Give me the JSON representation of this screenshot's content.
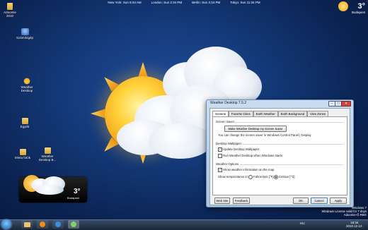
{
  "clocks": [
    "New York: Sun 8:34 AM",
    "London: Sun 2:34 PM",
    "Berlin: Sun 3:34 PM",
    "Tokyo: Sun 11:34 PM"
  ],
  "top_right_weather": {
    "temp": "3°",
    "city": "Budapest"
  },
  "desktop_icons": [
    {
      "label": "Adoomie\n2010",
      "icon": "folder-icon"
    },
    {
      "label": "Számítógép",
      "icon": "computer-icon"
    },
    {
      "label": "Weather\nDesktop",
      "icon": "weather-icon"
    },
    {
      "label": "Egyéb",
      "icon": "folder-icon"
    },
    {
      "label": "Minta fotók",
      "icon": "folder-icon"
    },
    {
      "label": "Weather\nDesktop B...",
      "icon": "folder-icon"
    }
  ],
  "gadget": {
    "temp": "3°",
    "city": "Budapest"
  },
  "dialog": {
    "title": "Weather Desktop 7.5.2",
    "tabs": [
      "General",
      "Favorite Cities",
      "Earth Weather",
      "Earth Background",
      "View Zones"
    ],
    "screen_saver_header": "Screen Saver",
    "screen_saver_button": "Make Weather Desktop my Screen Saver",
    "screen_saver_note": "You can change the screen saver in Windows Control Panel | Display",
    "wallpaper_header": "Desktop Wallpaper",
    "update_wallpaper": "Update Desktop Wallpaper",
    "run_on_start": "Run Weather Desktop when Windows starts",
    "weather_options_header": "Weather Options",
    "show_on_map": "Show weather information on the map",
    "temp_label": "Show temperatures in:",
    "fahrenheit": "Fahrenheit [°F]",
    "celsius": "Celsius [°C]",
    "buttons": {
      "website": "Web Site",
      "feedback": "Feedback",
      "ok": "OK",
      "cancel": "Cancel",
      "apply": "Apply"
    }
  },
  "watermark": {
    "line1": "Windows 7",
    "line2": "Windows License valid for 7 days",
    "line3": "Adoomie-Ő RBG"
  },
  "taskbar": {
    "lang": "HU",
    "time": "15:34",
    "date": "2010.12.12."
  }
}
